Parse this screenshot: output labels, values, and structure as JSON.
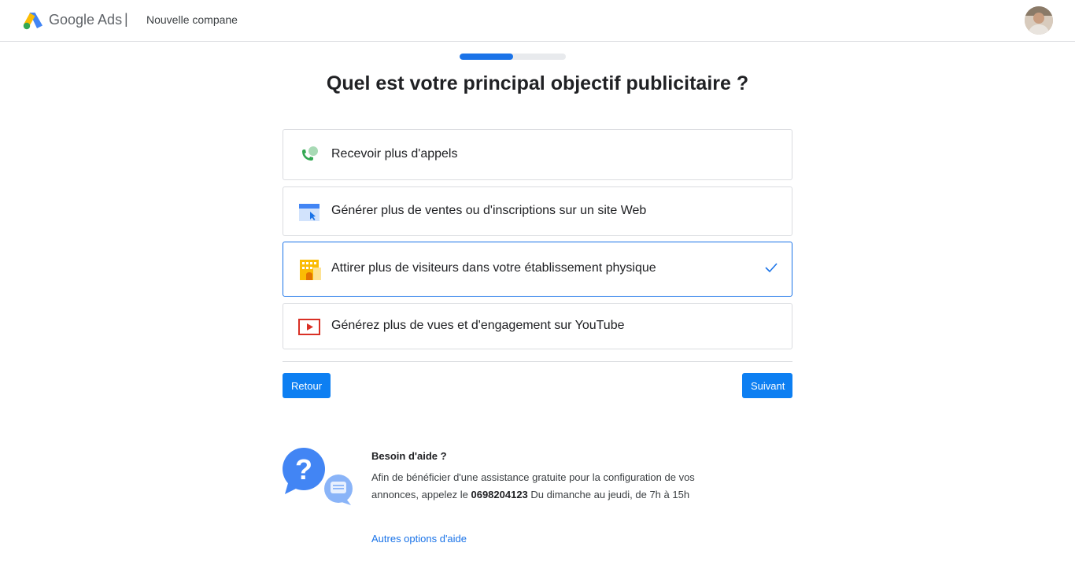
{
  "header": {
    "brand": "Google Ads",
    "separator": "|",
    "campaign_title": "Nouvelle compane",
    "avatar_icon": "user-avatar"
  },
  "progress": {
    "fraction": 0.5
  },
  "main": {
    "title": "Quel est votre principal objectif publicitaire ?",
    "options": [
      {
        "label": "Recevoir plus d'appels",
        "icon": "phone-call-icon",
        "selected": false
      },
      {
        "label": "Générer plus de ventes ou d'inscriptions sur un site Web",
        "icon": "website-icon",
        "selected": false
      },
      {
        "label": "Attirer plus de visiteurs dans votre établissement physique",
        "icon": "store-building-icon",
        "selected": true
      },
      {
        "label": "Générez plus de vues et d'engagement sur YouTube",
        "icon": "youtube-play-icon",
        "selected": false
      }
    ]
  },
  "buttons": {
    "back_label": "Retour",
    "next_label": "Suivant"
  },
  "help": {
    "title": "Besoin d'aide ?",
    "text_before": "Afin de bénéficier d'une assistance gratuite pour la configuration de vos annonces, appelez le ",
    "phone": "0698204123",
    "text_after": " Du dimanche au jeudi, de 7h à 15h",
    "link_label": "Autres options d'aide",
    "icon": "help-chat-icon"
  },
  "colors": {
    "accent": "#1a73e8",
    "button": "#0d7ff2",
    "border": "#dadce0"
  }
}
